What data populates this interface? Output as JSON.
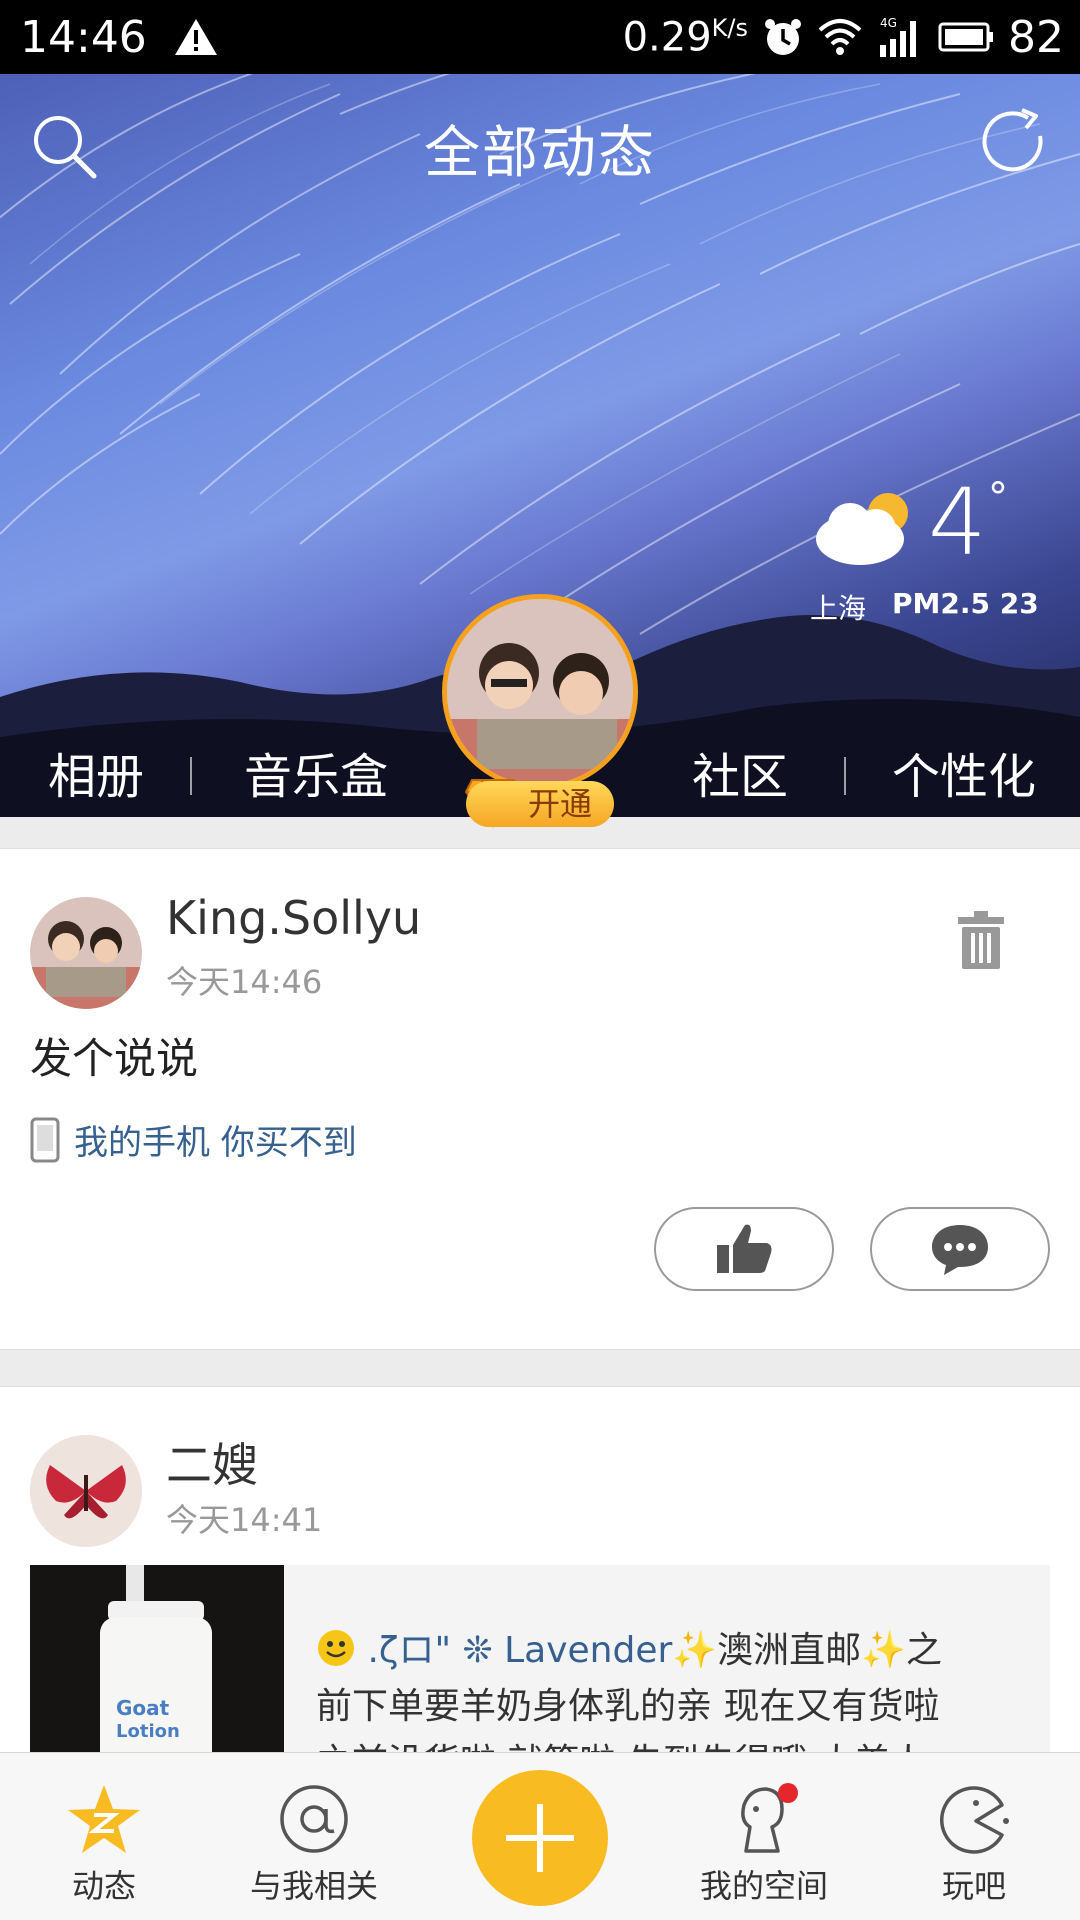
{
  "status_bar": {
    "time": "14:46",
    "net_speed": "0.29",
    "net_unit": "K/s",
    "network_type": "4G",
    "battery": "82"
  },
  "header": {
    "title": "全部动态",
    "weather": {
      "temperature": "4",
      "degree_symbol": "°",
      "city": "上海",
      "pm_label": "PM2.5",
      "pm_value": "23"
    },
    "nav": {
      "album": "相册",
      "music": "音乐盒",
      "community": "社区",
      "personalize": "个性化"
    },
    "vip_badge": "开通"
  },
  "feed": [
    {
      "user": "King.Sollyu",
      "time": "今天14:46",
      "text": "发个说说",
      "device": "我的手机 你买不到"
    },
    {
      "user": "二嫂",
      "time": "今天14:41",
      "shared_prefix": ".ζ",
      "shared_brand": "Lavender",
      "shared_line1_rest": "澳洲直邮",
      "shared_line1_end": "之",
      "shared_line2": "前下单要羊奶身体乳的亲 现在又有货啦",
      "shared_line3": "之前没货啦 就等啦 先到先得哦 大美人",
      "thumb_label_top": "Goat",
      "thumb_label_bottom": "Lotion"
    }
  ],
  "tab_bar": {
    "tabs": [
      {
        "label": "动态",
        "icon": "qzone-star-icon"
      },
      {
        "label": "与我相关",
        "icon": "at-icon"
      },
      {
        "label": "我的空间",
        "icon": "my-space-icon"
      },
      {
        "label": "玩吧",
        "icon": "pacman-icon"
      }
    ]
  },
  "colors": {
    "accent_orange": "#f8bb22",
    "link_blue": "#35608f",
    "notification_red": "#e5262b"
  }
}
